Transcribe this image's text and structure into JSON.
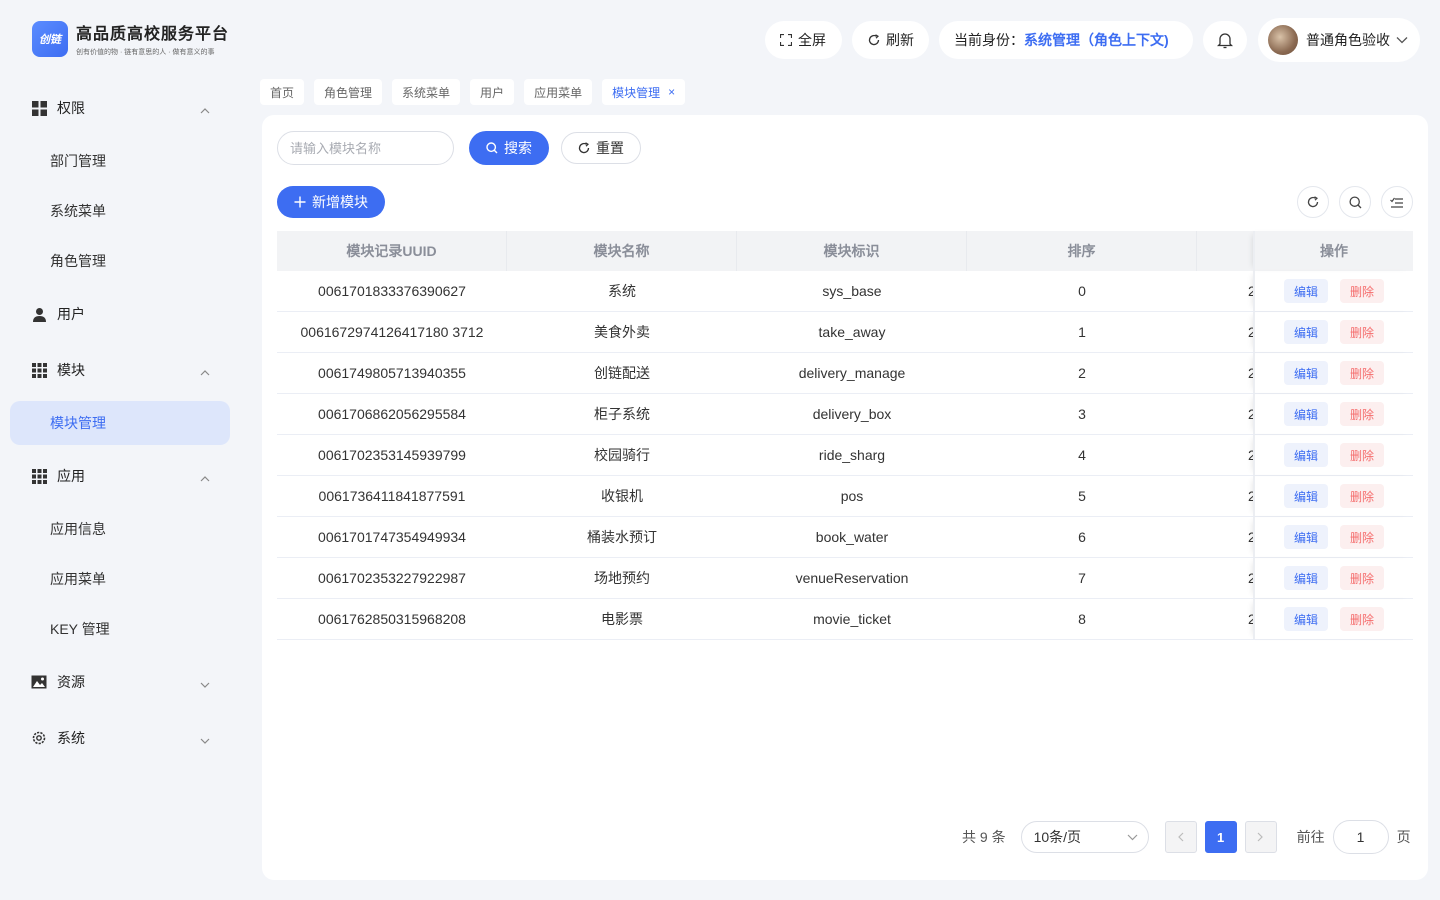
{
  "brand": {
    "logo_text": "创链",
    "title": "高品质高校服务平台",
    "subtitle": "创有价值的物 · 链有意思的人 · 做有意义的事"
  },
  "sidebar": {
    "groups": [
      {
        "label": "权限",
        "icon": "grid-icon",
        "expanded": true,
        "items": [
          "部门管理",
          "系统菜单",
          "角色管理"
        ]
      },
      {
        "label": "用户",
        "icon": "user-icon",
        "expanded": false,
        "items": []
      },
      {
        "label": "模块",
        "icon": "apps-icon",
        "expanded": true,
        "items": [
          "模块管理"
        ]
      },
      {
        "label": "应用",
        "icon": "apps-icon",
        "expanded": true,
        "items": [
          "应用信息",
          "应用菜单",
          "KEY 管理"
        ]
      },
      {
        "label": "资源",
        "icon": "image-icon",
        "expanded": false,
        "items": []
      },
      {
        "label": "系统",
        "icon": "gear-icon",
        "expanded": false,
        "items": []
      }
    ],
    "active_item": "模块管理"
  },
  "header": {
    "fullscreen_label": "全屏",
    "refresh_label": "刷新",
    "role_prefix": "当前身份：",
    "role_value": "系统管理（角色上下文)",
    "user_name": "普通角色验收"
  },
  "tabs": [
    {
      "label": "首页",
      "active": false
    },
    {
      "label": "角色管理",
      "active": false
    },
    {
      "label": "系统菜单",
      "active": false
    },
    {
      "label": "用户",
      "active": false
    },
    {
      "label": "应用菜单",
      "active": false
    },
    {
      "label": "模块管理",
      "active": true,
      "closable": true
    }
  ],
  "toolbar": {
    "search_placeholder": "请输入模块名称",
    "search_value": "",
    "search_label": "搜索",
    "reset_label": "重置",
    "add_label": "新增模块"
  },
  "table": {
    "columns": [
      "模块记录UUID",
      "模块名称",
      "模块标识",
      "排序",
      "",
      "操作"
    ],
    "rows": [
      {
        "uuid": "0061701833376390627",
        "name": "系统",
        "code": "sys_base",
        "sort": "0",
        "extra": "2"
      },
      {
        "uuid": "0061672974126417180 3712",
        "name": "美食外卖",
        "code": "take_away",
        "sort": "1",
        "extra": "2"
      },
      {
        "uuid": "0061749805713940355",
        "name": "创链配送",
        "code": "delivery_manage",
        "sort": "2",
        "extra": "2"
      },
      {
        "uuid": "0061706862056295584",
        "name": "柜子系统",
        "code": "delivery_box",
        "sort": "3",
        "extra": "2"
      },
      {
        "uuid": "0061702353145939799",
        "name": "校园骑行",
        "code": "ride_sharg",
        "sort": "4",
        "extra": "2"
      },
      {
        "uuid": "0061736411841877591",
        "name": "收银机",
        "code": "pos",
        "sort": "5",
        "extra": "2"
      },
      {
        "uuid": "0061701747354949934",
        "name": "桶装水预订",
        "code": "book_water",
        "sort": "6",
        "extra": "2"
      },
      {
        "uuid": "0061702353227922987",
        "name": "场地预约",
        "code": "venueReservation",
        "sort": "7",
        "extra": "2"
      },
      {
        "uuid": "0061762850315968208",
        "name": "电影票",
        "code": "movie_ticket",
        "sort": "8",
        "extra": "2"
      }
    ],
    "edit_label": "编辑",
    "delete_label": "删除"
  },
  "pagination": {
    "total_label": "共 9 条",
    "page_size": "10条/页",
    "current_page": "1",
    "goto_prefix": "前往",
    "goto_value": "1",
    "goto_suffix": "页"
  },
  "colors": {
    "primary": "#3d6df2",
    "danger": "#f56c6c",
    "background": "#f3f5f9"
  }
}
